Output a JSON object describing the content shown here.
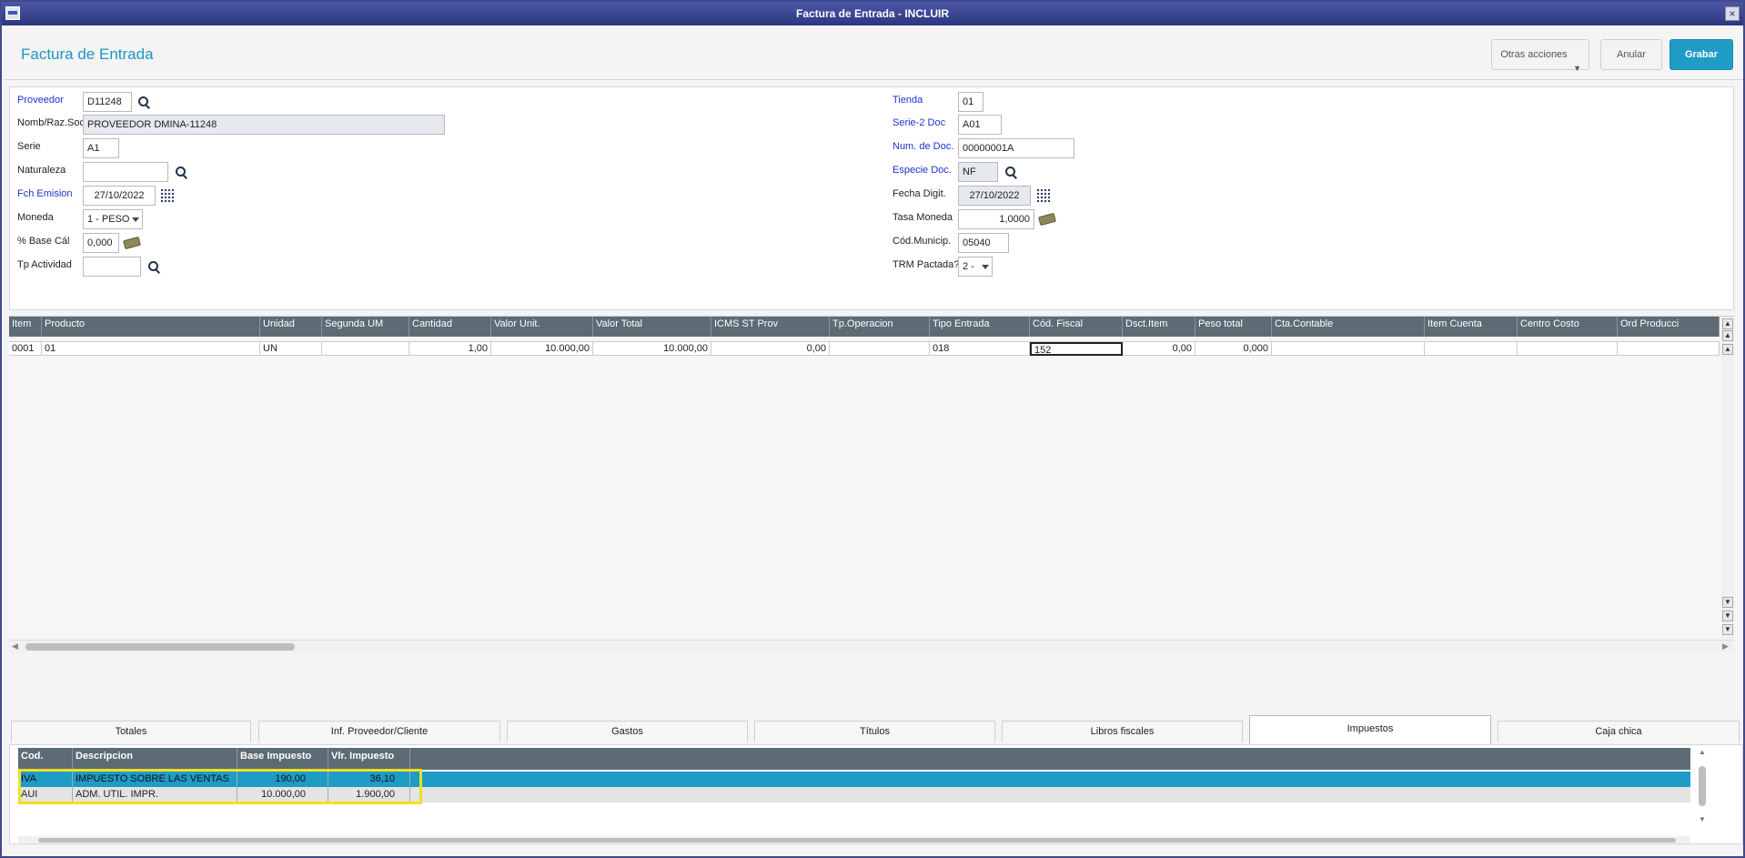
{
  "window": {
    "title": "Factura de Entrada - INCLUIR",
    "close_glyph": "×"
  },
  "header": {
    "title": "Factura de Entrada",
    "otras_label": "Otras acciones",
    "anular_label": "Anular",
    "grabar_label": "Grabar"
  },
  "form": {
    "proveedor": {
      "label": "Proveedor",
      "value": "D11248"
    },
    "nomb": {
      "label": "Nomb/Raz.Soc",
      "value": "PROVEEDOR DMINA-11248"
    },
    "serie": {
      "label": "Serie",
      "value": "A1"
    },
    "naturaleza": {
      "label": "Naturaleza",
      "value": ""
    },
    "fch_emision": {
      "label": "Fch Emision",
      "value": "27/10/2022"
    },
    "moneda": {
      "label": "Moneda",
      "value": "1 - PESO"
    },
    "base_cal": {
      "label": "% Base Cál",
      "value": "0,000"
    },
    "tp_actividad": {
      "label": "Tp Actividad",
      "value": ""
    },
    "tienda": {
      "label": "Tienda",
      "value": "01"
    },
    "serie2": {
      "label": "Serie-2 Doc",
      "value": "A01"
    },
    "num_doc": {
      "label": "Num. de Doc.",
      "value": "00000001A"
    },
    "especie": {
      "label": "Especie Doc.",
      "value": "NF"
    },
    "fecha_digit": {
      "label": "Fecha Digit.",
      "value": "27/10/2022"
    },
    "tasa_moneda": {
      "label": "Tasa Moneda",
      "value": "1,0000"
    },
    "cod_municip": {
      "label": "Cód.Municip.",
      "value": "05040"
    },
    "trm_pactada": {
      "label": "TRM Pactada?",
      "value": "2 -"
    }
  },
  "items_grid": {
    "headers": [
      "Item",
      "Producto",
      "Unidad",
      "Segunda UM",
      "Cantidad",
      "Valor Unit.",
      "Valor Total",
      "ICMS ST Prov",
      "Tp.Operacion",
      "Tipo Entrada",
      "Cód. Fiscal",
      "Dsct.Item",
      "Peso total",
      "Cta.Contable",
      "Item Cuenta",
      "Centro Costo",
      "Ord Producci"
    ],
    "row": [
      "0001",
      "01",
      "UN",
      "",
      "1,00",
      "10.000,00",
      "10.000,00",
      "0,00",
      "",
      "018",
      "152",
      "0,00",
      "0,000",
      "",
      "",
      "",
      ""
    ]
  },
  "tabs": [
    "Totales",
    "Inf. Proveedor/Cliente",
    "Gastos",
    "Títulos",
    "Libros fiscales",
    "Impuestos",
    "Caja chica"
  ],
  "active_tab": "Impuestos",
  "taxes": {
    "headers": [
      "Cod.",
      "Descripcion",
      "Base Impuesto",
      "Vlr. Impuesto"
    ],
    "rows": [
      [
        "IVA",
        "IMPUESTO SOBRE LAS VENTAS",
        "190,00",
        "36,10"
      ],
      [
        "AUI",
        "ADM. UTIL. IMPR.",
        "10.000,00",
        "1.900,00"
      ]
    ]
  },
  "colors": {
    "accent": "#1e9cc6",
    "title_bar": "#2c3680",
    "grid_header": "#5d6b74",
    "highlight": "#f0e020",
    "required_label": "#1a35c9"
  }
}
